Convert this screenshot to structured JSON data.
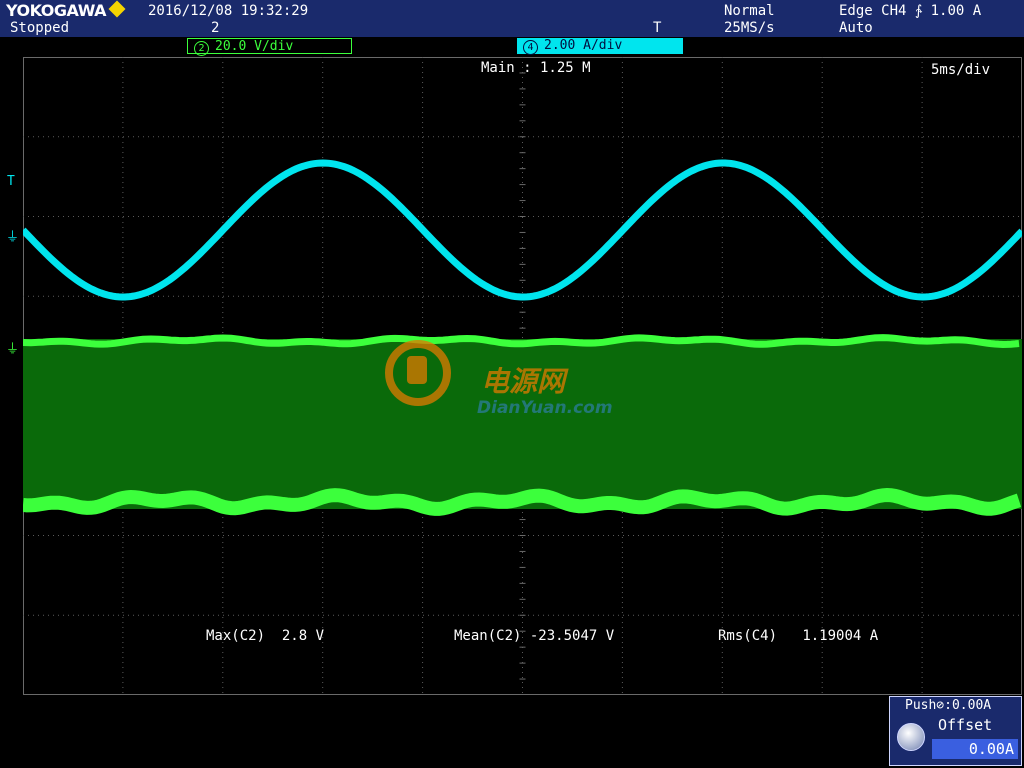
{
  "header": {
    "brand": "YOKOGAWA",
    "status": "Stopped",
    "timestamp": "2016/12/08 19:32:29",
    "acq_count": "2",
    "trigger_mode": "Normal",
    "sample_rate": "25MS/s",
    "trigger_setting": "Edge CH4 ∱ 1.00 A",
    "trigger_sweep": "Auto",
    "trigger_marker": "T"
  },
  "channels": {
    "ch2": {
      "num": "2",
      "scale": "20.0 V/div",
      "color": "#3cff3c"
    },
    "ch4": {
      "num": "4",
      "scale": "2.00 A/div",
      "color": "#00e5ee"
    }
  },
  "timebase": {
    "main": "Main : 1.25 M",
    "scale": "5ms/div"
  },
  "markers": {
    "trigger_level": "T",
    "ch4_ground": "⏚",
    "ch2_ground": "⏚"
  },
  "measurements": [
    {
      "label": "Max(C2)",
      "value": "2.8 V"
    },
    {
      "label": "Mean(C2)",
      "value": "-23.5047 V"
    },
    {
      "label": "Rms(C4)",
      "value": "1.19004 A"
    }
  ],
  "watermark": {
    "cn": "电源网",
    "en": "DianYuan.com"
  },
  "offset_panel": {
    "push_label": "Push⊘:0.00A",
    "label": "Offset",
    "value": "0.00A"
  },
  "colors": {
    "ch2": "#3cff3c",
    "ch4": "#00e5ee",
    "header_bg": "#1a2a6c"
  }
}
